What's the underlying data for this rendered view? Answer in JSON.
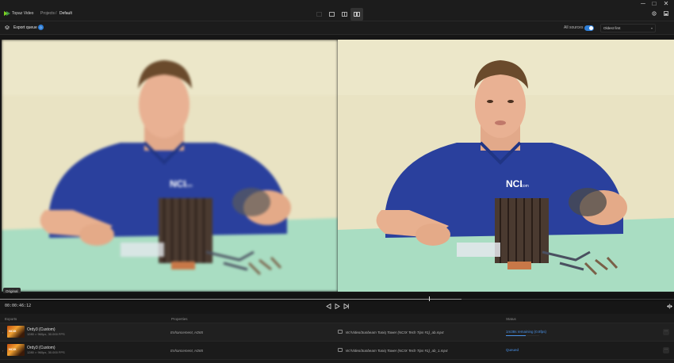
{
  "app": {
    "name": "Topaz Video"
  },
  "breadcrumb": {
    "parent": "Projects",
    "separator": "/",
    "current": "Default"
  },
  "window_controls": {
    "minimize": "─",
    "maximize": "□",
    "close": "✕"
  },
  "view_modes": [
    {
      "name": "single-view",
      "active": false
    },
    {
      "name": "overlay-view",
      "active": false
    },
    {
      "name": "split-view",
      "active": false
    },
    {
      "name": "side-by-side-view",
      "active": true
    }
  ],
  "subbar": {
    "export_queue_label": "Export queue",
    "export_queue_count": "0",
    "all_sources_label": "All sources",
    "all_sources_enabled": true,
    "sort_selected": "Oldest first"
  },
  "viewer": {
    "left_label": "Original",
    "shirt_logo": "NCI",
    "shirt_logo_sub": ".com"
  },
  "playback": {
    "timecode": "00:00:46:12",
    "buffered_fraction": 0.685,
    "position_fraction": 0.636
  },
  "exports": {
    "columns": {
      "exports": "Exports",
      "properties": "Properties",
      "status": "Status"
    },
    "rows": [
      {
        "thumb_text": "NCIX",
        "name": "Ordy3 (Custom)",
        "meta": "1280 × 960px, 30.000 FPS",
        "properties": "Enhancement, H265",
        "path": "W:/Video/Sunbeam Tuniq Tower (NCIX Tech Tips #1)_ab.mp4",
        "status": "1m38s remaining (0.8fps)",
        "progress": 0.6
      },
      {
        "thumb_text": "NCIX",
        "name": "Ordy3 (Custom)",
        "meta": "1280 × 960px, 30.000 FPS",
        "properties": "Enhancement, H265",
        "path": "W:/Video/Sunbeam Tuniq Tower (NCIX Tech Tips #1)_ab_1.mp4",
        "status": "Queued",
        "progress": null
      }
    ]
  },
  "colors": {
    "accent": "#2f7fd8",
    "wall": "#e8e2c0",
    "table": "#a8dcc0",
    "shirt": "#2a3f9a"
  }
}
